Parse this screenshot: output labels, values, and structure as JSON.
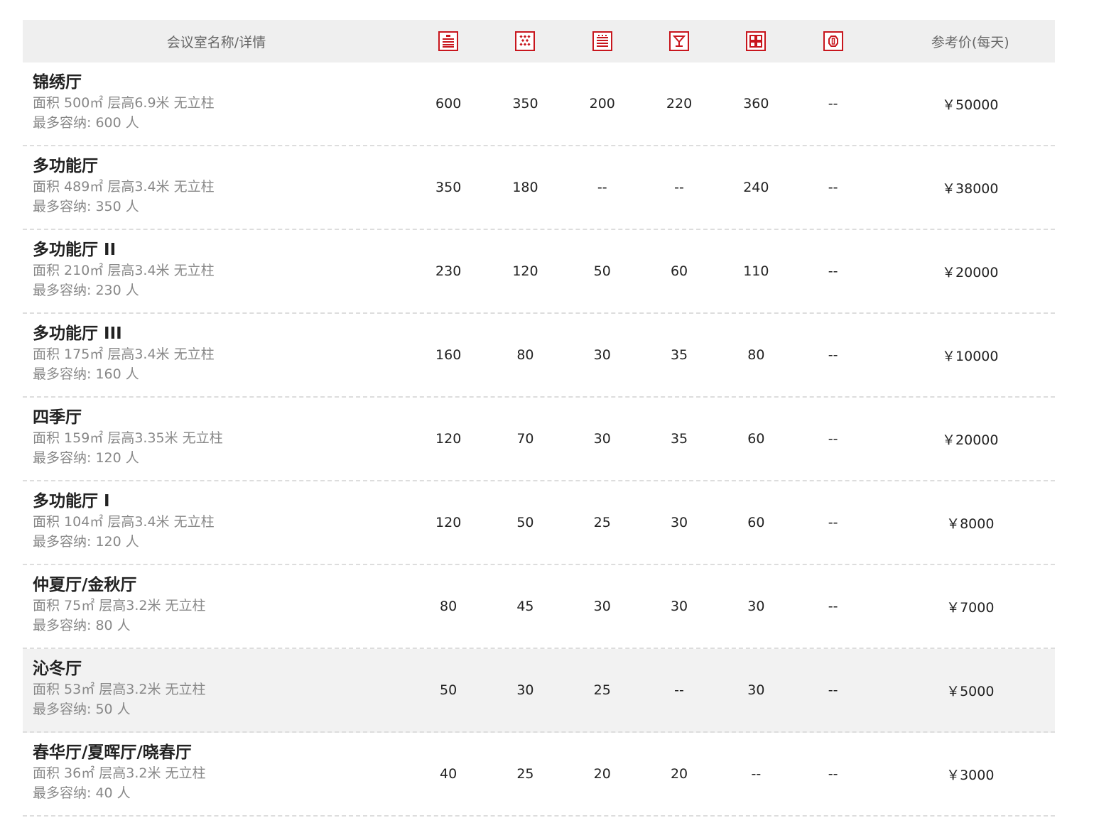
{
  "header": {
    "name_label": "会议室名称/详情",
    "price_label": "参考价(每天)",
    "layout_icons": [
      "theater-layout-icon",
      "banquet-layout-icon",
      "classroom-layout-icon",
      "cocktail-layout-icon",
      "u-shape-layout-icon",
      "boardroom-layout-icon"
    ],
    "icon_color": "#c8161d"
  },
  "rooms": [
    {
      "name": "锦绣厅",
      "detail": "面积 500㎡ 层高6.9米 无立柱",
      "capacity": "最多容纳: 600 人",
      "values": [
        "600",
        "350",
        "200",
        "220",
        "360",
        "--"
      ],
      "price": "￥50000"
    },
    {
      "name": "多功能厅",
      "detail": "面积 489㎡ 层高3.4米 无立柱",
      "capacity": "最多容纳: 350 人",
      "values": [
        "350",
        "180",
        "--",
        "--",
        "240",
        "--"
      ],
      "price": "￥38000"
    },
    {
      "name": "多功能厅 II",
      "detail": "面积 210㎡ 层高3.4米 无立柱",
      "capacity": "最多容纳: 230 人",
      "values": [
        "230",
        "120",
        "50",
        "60",
        "110",
        "--"
      ],
      "price": "￥20000"
    },
    {
      "name": "多功能厅 III",
      "detail": "面积 175㎡ 层高3.4米 无立柱",
      "capacity": "最多容纳: 160 人",
      "values": [
        "160",
        "80",
        "30",
        "35",
        "80",
        "--"
      ],
      "price": "￥10000"
    },
    {
      "name": "四季厅",
      "detail": "面积 159㎡ 层高3.35米 无立柱",
      "capacity": "最多容纳: 120 人",
      "values": [
        "120",
        "70",
        "30",
        "35",
        "60",
        "--"
      ],
      "price": "￥20000"
    },
    {
      "name": "多功能厅 I",
      "detail": "面积 104㎡ 层高3.4米 无立柱",
      "capacity": "最多容纳: 120 人",
      "values": [
        "120",
        "50",
        "25",
        "30",
        "60",
        "--"
      ],
      "price": "￥8000"
    },
    {
      "name": "仲夏厅/金秋厅",
      "detail": "面积 75㎡ 层高3.2米 无立柱",
      "capacity": "最多容纳: 80 人",
      "values": [
        "80",
        "45",
        "30",
        "30",
        "30",
        "--"
      ],
      "price": "￥7000"
    },
    {
      "name": "沁冬厅",
      "detail": "面积 53㎡ 层高3.2米 无立柱",
      "capacity": "最多容纳: 50 人",
      "values": [
        "50",
        "30",
        "25",
        "--",
        "30",
        "--"
      ],
      "price": "￥5000"
    },
    {
      "name": "春华厅/夏晖厅/晓春厅",
      "detail": "面积 36㎡ 层高3.2米 无立柱",
      "capacity": "最多容纳: 40 人",
      "values": [
        "40",
        "25",
        "20",
        "20",
        "--",
        "--"
      ],
      "price": "￥3000"
    }
  ]
}
